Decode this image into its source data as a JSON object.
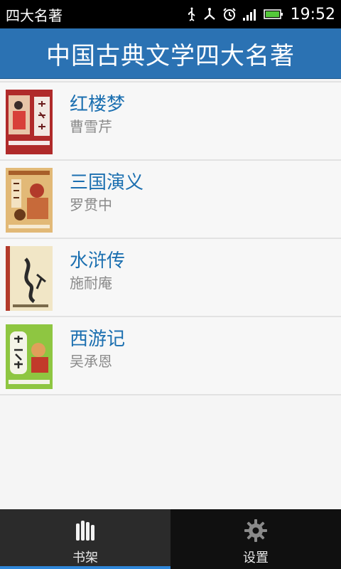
{
  "statusbar": {
    "app_name": "四大名著",
    "time": "19:52"
  },
  "header": {
    "title": "中国古典文学四大名著"
  },
  "books": [
    {
      "title": "红楼梦",
      "author": "曹雪芹",
      "cover_icon": "book-cover-hongloumeng",
      "cover_color": "#c23a3a"
    },
    {
      "title": "三国演义",
      "author": "罗贯中",
      "cover_icon": "book-cover-sanguoyanyi",
      "cover_color": "#d7a75d"
    },
    {
      "title": "水浒传",
      "author": "施耐庵",
      "cover_icon": "book-cover-shuihuzhuan",
      "cover_color": "#d9b97d"
    },
    {
      "title": "西游记",
      "author": "吴承恩",
      "cover_icon": "book-cover-xiyouji",
      "cover_color": "#85c23a"
    }
  ],
  "tabs": [
    {
      "label": "书架",
      "icon": "bookshelf-icon",
      "active": true
    },
    {
      "label": "设置",
      "icon": "gear-icon",
      "active": false
    }
  ],
  "colors": {
    "header_bg": "#2b72b3",
    "title_text": "#1b6fb0",
    "active_tab_indicator": "#2e86d9"
  }
}
